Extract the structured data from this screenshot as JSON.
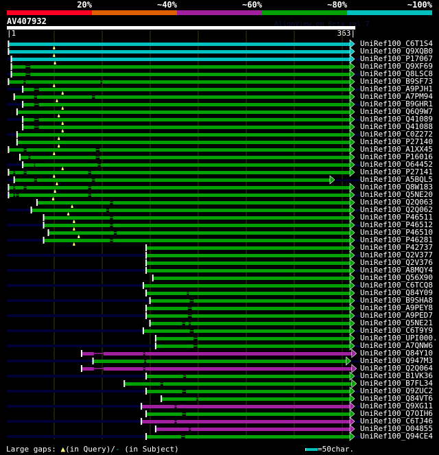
{
  "header": {
    "percent_labels": [
      "20%",
      "~40%",
      "~60%",
      "~80%",
      "~100%"
    ],
    "percent_colors": [
      "#ff0020",
      "#e06000",
      "#a020a0",
      "#00a000",
      "#00c0c0"
    ],
    "query_name": "AV407932",
    "version": "AlignView.pm Beta rel.7",
    "start_label": "|1",
    "end_label": "363|"
  },
  "query_length": 363,
  "rows": [
    {
      "name": "UniRef100_C6T1S4",
      "color": "#00c0c0",
      "start": 2,
      "end": 363,
      "gaps": [],
      "marks": [
        50
      ],
      "leader": false
    },
    {
      "name": "UniRef100_Q9XQB0",
      "color": "#00c0c0",
      "start": 2,
      "end": 363,
      "gaps": [],
      "marks": [
        50
      ],
      "leader": false
    },
    {
      "name": "UniRef100_P17067",
      "color": "#00c0c0",
      "start": 5,
      "end": 363,
      "gaps": [],
      "marks": [
        51
      ],
      "leader": true
    },
    {
      "name": "UniRef100_Q9XF69",
      "color": "#00a000",
      "start": 5,
      "end": 363,
      "gaps": [
        [
          20,
          25
        ]
      ],
      "marks": [],
      "leader": false
    },
    {
      "name": "UniRef100_Q8LSC8",
      "color": "#00a000",
      "start": 5,
      "end": 363,
      "gaps": [
        [
          20,
          25
        ]
      ],
      "marks": [],
      "leader": true
    },
    {
      "name": "UniRef100_B9SF73",
      "color": "#00a000",
      "start": 2,
      "end": 363,
      "gaps": [
        [
          18,
          20
        ],
        [
          99,
          101
        ]
      ],
      "marks": [
        50
      ],
      "leader": false
    },
    {
      "name": "UniRef100_A9PJH1",
      "color": "#00a000",
      "start": 17,
      "end": 363,
      "gaps": [
        [
          29,
          34
        ]
      ],
      "marks": [
        59
      ],
      "leader": true
    },
    {
      "name": "UniRef100_A7PM94",
      "color": "#00a000",
      "start": 8,
      "end": 363,
      "gaps": [
        [
          29,
          32
        ],
        [
          90,
          93
        ]
      ],
      "marks": [
        53
      ],
      "leader": false
    },
    {
      "name": "UniRef100_B9GHR1",
      "color": "#00a000",
      "start": 17,
      "end": 363,
      "gaps": [
        [
          29,
          34
        ]
      ],
      "marks": [
        59
      ],
      "leader": true
    },
    {
      "name": "UniRef100_Q6Q9W7",
      "color": "#00a000",
      "start": 11,
      "end": 363,
      "gaps": [],
      "marks": [
        55
      ],
      "leader": false
    },
    {
      "name": "UniRef100_Q41089",
      "color": "#00a000",
      "start": 17,
      "end": 363,
      "gaps": [
        [
          29,
          34
        ]
      ],
      "marks": [
        59
      ],
      "leader": true
    },
    {
      "name": "UniRef100_Q41088",
      "color": "#00a000",
      "start": 17,
      "end": 363,
      "gaps": [
        [
          29,
          34
        ]
      ],
      "marks": [
        59
      ],
      "leader": false
    },
    {
      "name": "UniRef100_C0Z272",
      "color": "#00a000",
      "start": 11,
      "end": 363,
      "gaps": [],
      "marks": [
        55
      ],
      "leader": true
    },
    {
      "name": "UniRef100_P27140",
      "color": "#00a000",
      "start": 11,
      "end": 363,
      "gaps": [],
      "marks": [
        55
      ],
      "leader": false
    },
    {
      "name": "UniRef100_A1XX45",
      "color": "#00a000",
      "start": 2,
      "end": 363,
      "gaps": [
        [
          18,
          21
        ],
        [
          94,
          98
        ]
      ],
      "marks": [
        50
      ],
      "leader": false
    },
    {
      "name": "UniRef100_P16016",
      "color": "#00a000",
      "start": 14,
      "end": 363,
      "gaps": [
        [
          23,
          25
        ],
        [
          94,
          98
        ]
      ],
      "marks": [],
      "leader": false
    },
    {
      "name": "UniRef100_O64452",
      "color": "#00a000",
      "start": 17,
      "end": 363,
      "gaps": [
        [
          29,
          30
        ],
        [
          96,
          99
        ]
      ],
      "marks": [
        59
      ],
      "leader": true
    },
    {
      "name": "UniRef100_P27141",
      "color": "#00a000",
      "start": 2,
      "end": 363,
      "gaps": [
        [
          7,
          9
        ],
        [
          18,
          21
        ],
        [
          86,
          89
        ]
      ],
      "marks": [
        50
      ],
      "leader": false
    },
    {
      "name": "UniRef100_A5BQL5",
      "color": "#00a000",
      "start": 8,
      "end": 342,
      "gaps": [
        [
          29,
          32
        ],
        [
          90,
          93
        ]
      ],
      "marks": [
        53
      ],
      "leader": true
    },
    {
      "name": "UniRef100_Q8W183",
      "color": "#00a000",
      "start": 2,
      "end": 363,
      "gaps": [
        [
          7,
          9
        ],
        [
          18,
          21
        ],
        [
          86,
          89
        ]
      ],
      "marks": [
        51
      ],
      "leader": false
    },
    {
      "name": "UniRef100_Q5NE20",
      "color": "#00a000",
      "start": 2,
      "end": 363,
      "gaps": [
        [
          7,
          9
        ],
        [
          10,
          13
        ],
        [
          86,
          89
        ]
      ],
      "marks": [
        49
      ],
      "leader": true
    },
    {
      "name": "UniRef100_Q2Q063",
      "color": "#00a000",
      "start": 32,
      "end": 363,
      "gaps": [
        [
          109,
          112
        ]
      ],
      "marks": [
        69
      ],
      "leader": false
    },
    {
      "name": "UniRef100_Q2Q062",
      "color": "#00a000",
      "start": 26,
      "end": 363,
      "gaps": [
        [
          105,
          108
        ]
      ],
      "marks": [
        65
      ],
      "leader": true
    },
    {
      "name": "UniRef100_P46511",
      "color": "#00a000",
      "start": 39,
      "end": 363,
      "gaps": [
        [
          109,
          112
        ]
      ],
      "marks": [
        71
      ],
      "leader": false
    },
    {
      "name": "UniRef100_P46512",
      "color": "#00a000",
      "start": 39,
      "end": 363,
      "gaps": [
        [
          109,
          112
        ]
      ],
      "marks": [
        71
      ],
      "leader": true
    },
    {
      "name": "UniRef100_P46510",
      "color": "#00a000",
      "start": 44,
      "end": 363,
      "gaps": [
        [
          113,
          116
        ]
      ],
      "marks": [
        76
      ],
      "leader": false
    },
    {
      "name": "UniRef100_P46281",
      "color": "#00a000",
      "start": 39,
      "end": 363,
      "gaps": [
        [
          109,
          112
        ]
      ],
      "marks": [
        71
      ],
      "leader": true
    },
    {
      "name": "UniRef100_P42737",
      "color": "#00a000",
      "start": 147,
      "end": 363,
      "gaps": [],
      "marks": [],
      "leader": false
    },
    {
      "name": "UniRef100_Q2V377",
      "color": "#00a000",
      "start": 147,
      "end": 363,
      "gaps": [],
      "marks": [],
      "leader": true
    },
    {
      "name": "UniRef100_Q2V376",
      "color": "#00a000",
      "start": 147,
      "end": 363,
      "gaps": [],
      "marks": [],
      "leader": false
    },
    {
      "name": "UniRef100_A8MQY4",
      "color": "#00a000",
      "start": 147,
      "end": 363,
      "gaps": [],
      "marks": [],
      "leader": true
    },
    {
      "name": "UniRef100_Q56X90",
      "color": "#00a000",
      "start": 154,
      "end": 363,
      "gaps": [],
      "marks": [],
      "leader": false
    },
    {
      "name": "UniRef100_C6TCQ8",
      "color": "#00a000",
      "start": 144,
      "end": 363,
      "gaps": [],
      "marks": [],
      "leader": true
    },
    {
      "name": "UniRef100_Q84Y09",
      "color": "#00a000",
      "start": 147,
      "end": 363,
      "gaps": [
        [
          190,
          192
        ]
      ],
      "marks": [],
      "leader": false
    },
    {
      "name": "UniRef100_B9SHA8",
      "color": "#00a000",
      "start": 151,
      "end": 363,
      "gaps": [
        [
          193,
          197
        ]
      ],
      "marks": [],
      "leader": true
    },
    {
      "name": "UniRef100_A9PEY8",
      "color": "#00a000",
      "start": 147,
      "end": 363,
      "gaps": [
        [
          191,
          195
        ]
      ],
      "marks": [],
      "leader": false
    },
    {
      "name": "UniRef100_A9PED7",
      "color": "#00a000",
      "start": 147,
      "end": 363,
      "gaps": [
        [
          191,
          195
        ]
      ],
      "marks": [],
      "leader": true
    },
    {
      "name": "UniRef100_Q5NE21",
      "color": "#00a000",
      "start": 151,
      "end": 363,
      "gaps": [
        [
          185,
          188
        ],
        [
          192,
          194
        ]
      ],
      "marks": [],
      "leader": false
    },
    {
      "name": "UniRef100_C6T9Y9",
      "color": "#00a000",
      "start": 144,
      "end": 363,
      "gaps": [
        [
          193,
          197
        ]
      ],
      "marks": [],
      "leader": true
    },
    {
      "name": "UniRef100_UPI000..",
      "color": "#00a000",
      "start": 157,
      "end": 363,
      "gaps": [
        [
          197,
          201
        ]
      ],
      "marks": [],
      "leader": false
    },
    {
      "name": "UniRef100_A7QNW6",
      "color": "#00a000",
      "start": 157,
      "end": 363,
      "gaps": [
        [
          197,
          201
        ]
      ],
      "marks": [],
      "leader": true
    },
    {
      "name": "UniRef100_Q84Y10",
      "color": "#a020a0",
      "start": 79,
      "end": 365,
      "gaps": [
        [
          92,
          102
        ],
        [
          144,
          146
        ]
      ],
      "marks": [],
      "leader": false
    },
    {
      "name": "UniRef100_Q947M3",
      "color": "#00a000",
      "start": 91,
      "end": 359,
      "gaps": [
        [
          145,
          147
        ]
      ],
      "marks": [],
      "leader": true
    },
    {
      "name": "UniRef100_Q2Q064",
      "color": "#a020a0",
      "start": 79,
      "end": 365,
      "gaps": [
        [
          92,
          102
        ],
        [
          144,
          146
        ]
      ],
      "marks": [],
      "leader": false
    },
    {
      "name": "UniRef100_B1VK36",
      "color": "#00a000",
      "start": 147,
      "end": 363,
      "gaps": [
        [
          186,
          189
        ]
      ],
      "marks": [],
      "leader": true
    },
    {
      "name": "UniRef100_B7FL34",
      "color": "#00a000",
      "start": 124,
      "end": 365,
      "gaps": [
        [
          162,
          165
        ]
      ],
      "marks": [],
      "leader": false
    },
    {
      "name": "UniRef100_Q9ZUC2",
      "color": "#00a000",
      "start": 147,
      "end": 363,
      "gaps": [
        [
          185,
          189
        ]
      ],
      "marks": [],
      "leader": true
    },
    {
      "name": "UniRef100_Q84VT6",
      "color": "#00a000",
      "start": 163,
      "end": 363,
      "gaps": [
        [
          200,
          202
        ]
      ],
      "marks": [],
      "leader": false
    },
    {
      "name": "UniRef100_Q9XG11",
      "color": "#a020a0",
      "start": 142,
      "end": 363,
      "gaps": [
        [
          177,
          179
        ]
      ],
      "marks": [],
      "leader": true
    },
    {
      "name": "UniRef100_Q7OIH6",
      "color": "#00a000",
      "start": 147,
      "end": 363,
      "gaps": [
        [
          185,
          189
        ]
      ],
      "marks": [],
      "leader": false
    },
    {
      "name": "UniRef100_C6TJ46",
      "color": "#a020a0",
      "start": 142,
      "end": 363,
      "gaps": [
        [
          177,
          179
        ]
      ],
      "marks": [],
      "leader": true
    },
    {
      "name": "UniRef100_O04855",
      "color": "#a020a0",
      "start": 157,
      "end": 363,
      "gaps": [
        [
          192,
          194
        ]
      ],
      "marks": [],
      "leader": false
    },
    {
      "name": "UniRef100_Q94CE4",
      "color": "#00a000",
      "start": 147,
      "end": 363,
      "gaps": [
        [
          184,
          188
        ]
      ],
      "marks": [],
      "leader": true
    }
  ],
  "footer": {
    "gaps_label": "Large gaps:",
    "query_mark": "▲",
    "query_text": "(in Query)/",
    "subject_mark": "-",
    "subject_text": " (in Subject)",
    "scale_text": "=50char."
  }
}
